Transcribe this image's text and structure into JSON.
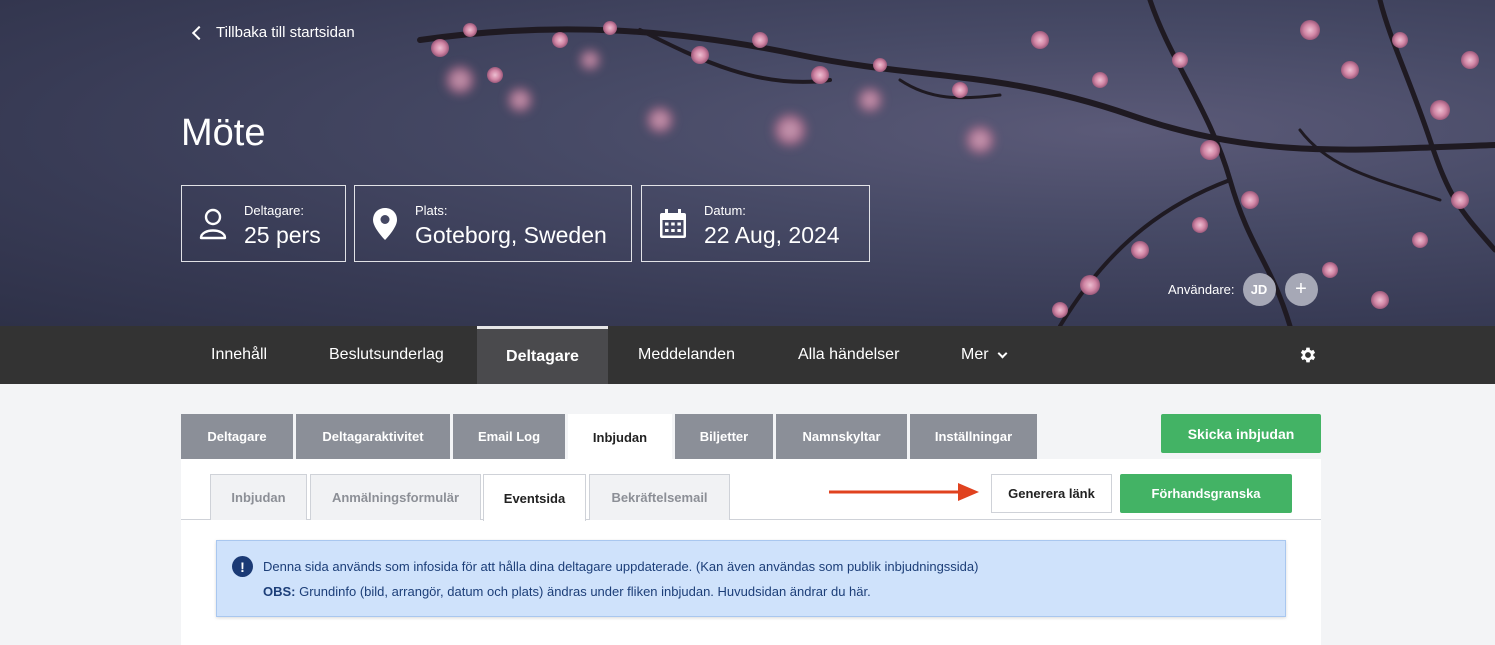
{
  "hero": {
    "back_link": "Tillbaka till startsidan",
    "title": "Möte",
    "info": [
      {
        "label": "Deltagare:",
        "value": "25 pers",
        "icon": "person-icon"
      },
      {
        "label": "Plats:",
        "value": "Goteborg, Sweden",
        "icon": "location-pin-icon"
      },
      {
        "label": "Datum:",
        "value": "22 Aug, 2024",
        "icon": "calendar-icon"
      }
    ],
    "users_label": "Användare:",
    "user_initials": "JD",
    "add_user": "+"
  },
  "nav": {
    "items": [
      "Innehåll",
      "Beslutsunderlag",
      "Deltagare",
      "Meddelanden",
      "Alla händelser",
      "Mer"
    ],
    "active": "Deltagare"
  },
  "tabs": {
    "items": [
      "Deltagare",
      "Deltagaraktivitet",
      "Email Log",
      "Inbjudan",
      "Biljetter",
      "Namnskyltar",
      "Inställningar"
    ],
    "active": "Inbjudan"
  },
  "send_invite_button": "Skicka inbjudan",
  "subtabs": {
    "items": [
      "Inbjudan",
      "Anmälningsformulär",
      "Eventsida",
      "Bekräftelsemail"
    ],
    "active": "Eventsida"
  },
  "generate_link_button": "Generera länk",
  "preview_button": "Förhandsgranska",
  "notice": {
    "line1": "Denna sida används som infosida för att hålla dina deltagare uppdaterade. (Kan även användas som publik inbjudningssida)",
    "line2_bold": "OBS:",
    "line2_rest": " Grundinfo (bild, arrangör, datum och plats) ändras under fliken inbjudan. Huvudsidan ändrar du här."
  },
  "colors": {
    "accent_green": "#43b365",
    "nav_bg": "#333333",
    "tab_gray": "#8b8f98",
    "notice_bg": "#cfe2fb",
    "arrow": "#e0421f"
  }
}
